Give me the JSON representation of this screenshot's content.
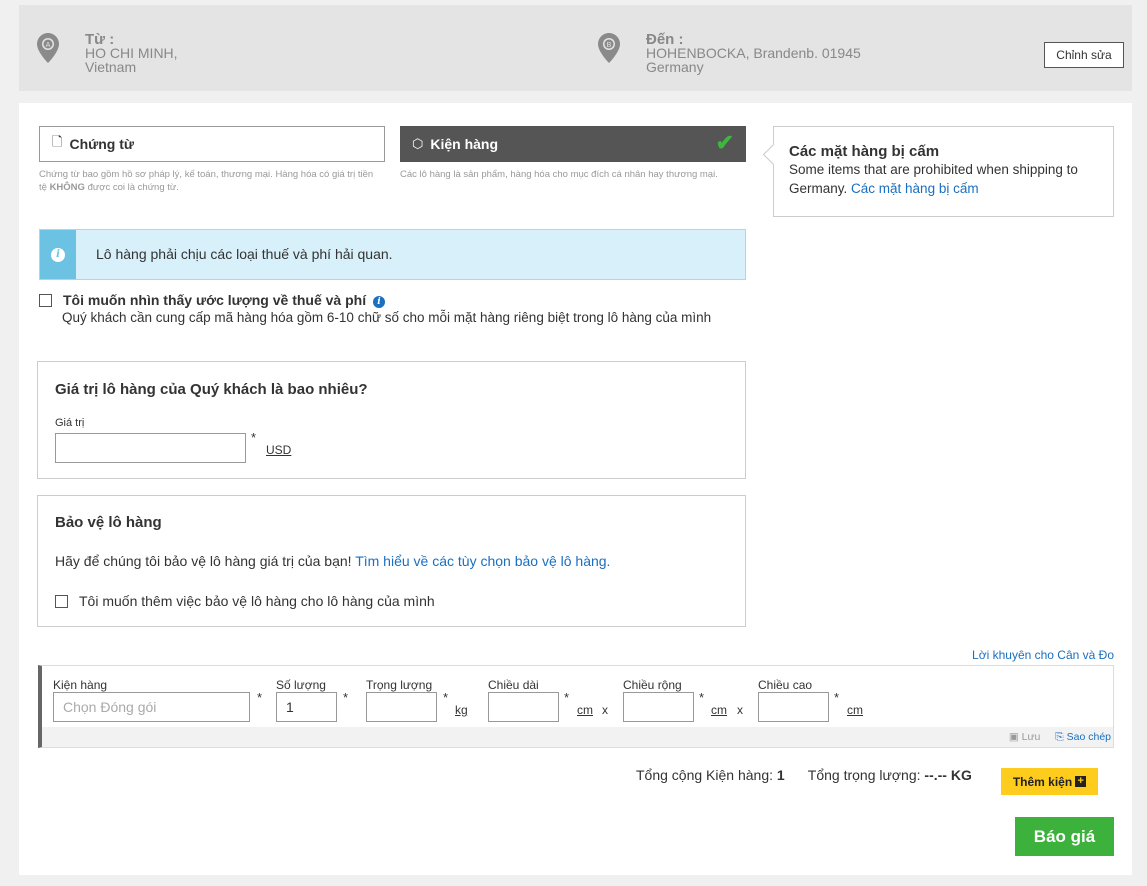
{
  "header": {
    "from": {
      "label": "Từ :",
      "city": "HO CHI MINH,",
      "country": "Vietnam",
      "pin_letter": "A"
    },
    "to": {
      "label": "Đến :",
      "city": "HOHENBOCKA, Brandenb. 01945",
      "country": "Germany",
      "pin_letter": "B"
    },
    "edit_label": "Chỉnh sửa"
  },
  "tabs": {
    "documents": {
      "label": "Chứng từ",
      "description_parts": [
        "Chứng từ bao gồm hồ sơ pháp lý, kế toán, thương mại. Hàng hóa có giá trị tiền tệ ",
        "KHÔNG",
        " được coi là chứng từ."
      ]
    },
    "packages": {
      "label": "Kiện hàng",
      "description": "Các lô hàng là sản phẩm, hàng hóa cho mục đích cá nhân hay thương mại.",
      "selected": true
    }
  },
  "prohibited": {
    "title": "Các mặt hàng bị cấm",
    "text": "Some items that are prohibited when shipping to Germany.",
    "link": "Các mặt hàng bị cấm"
  },
  "notice": {
    "text": "Lô hàng phải chịu các loại thuế và phí hải quan."
  },
  "tax_estimate": {
    "label": "Tôi muốn nhìn thấy ước lượng về thuế và phí",
    "hint": "Quý khách cần cung cấp mã hàng hóa gồm 6-10 chữ số cho mỗi mặt hàng riêng biệt trong lô hàng của mình",
    "checked": false
  },
  "shipment_value": {
    "title": "Giá trị lô hàng của Quý khách là bao nhiêu?",
    "field_label": "Giá trị",
    "value": "",
    "currency": "USD",
    "required": "*"
  },
  "protection": {
    "title": "Bảo vệ lô hàng",
    "text": "Hãy để chúng tôi bảo vệ lô hàng giá trị của bạn!",
    "link": "Tìm hiểu về các tùy chọn bảo vệ lô hàng.",
    "checkbox_label": "Tôi muốn thêm việc bảo vệ lô hàng cho lô hàng của mình",
    "checked": false
  },
  "advice_link": "Lời khuyên cho Cân và Đo",
  "package_row": {
    "package": {
      "label": "Kiện hàng",
      "placeholder": "Chọn Đóng gói"
    },
    "quantity": {
      "label": "Số lượng",
      "value": "1"
    },
    "weight": {
      "label": "Trọng lượng",
      "value": "",
      "unit": "kg"
    },
    "length": {
      "label": "Chiều dài",
      "value": "",
      "unit": "cm"
    },
    "width": {
      "label": "Chiều rộng",
      "value": "",
      "unit": "cm"
    },
    "height": {
      "label": "Chiều cao",
      "value": "",
      "unit": "cm"
    },
    "times": "x",
    "required": "*",
    "save_label": "Lưu",
    "copy_label": "Sao chép"
  },
  "totals": {
    "packages_label": "Tổng cộng Kiện hàng:",
    "packages_value": "1",
    "weight_label": "Tổng trọng lượng:",
    "weight_value": "--.-- KG"
  },
  "add_package_label": "Thêm kiện",
  "quote_label": "Báo giá",
  "colors": {
    "accent_green": "#3cb13c",
    "accent_yellow": "#fdcc1c",
    "link_blue": "#1a6fc0",
    "notice_bg": "#d8f0fa"
  }
}
